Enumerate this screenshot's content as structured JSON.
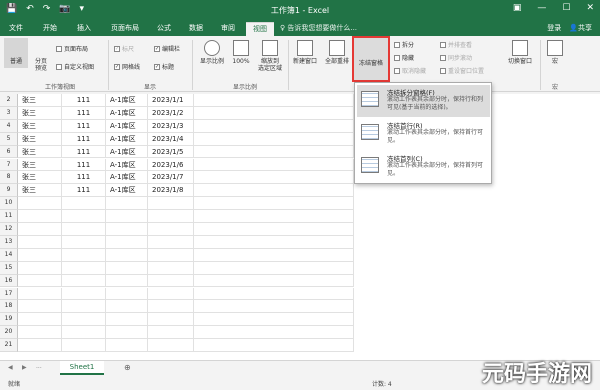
{
  "window": {
    "title": "工作簿1 - Excel"
  },
  "qat": {
    "save": "💾",
    "undo": "↶",
    "redo": "↷",
    "camera": "📷",
    "more": "▾"
  },
  "winbtns": {
    "ribbon_opts": "▣",
    "minimize": "—",
    "maximize": "☐",
    "close": "✕"
  },
  "tabs": [
    "文件",
    "开始",
    "插入",
    "页面布局",
    "公式",
    "数据",
    "审阅",
    "视图"
  ],
  "tellme": "♀ 告诉我您想要做什么...",
  "account": {
    "login": "登录",
    "share": "共享"
  },
  "ribbon": {
    "views": {
      "normal": "普通",
      "pagebreak_1": "分页",
      "pagebreak_2": "预览",
      "page_layout": "页面布局",
      "custom_views": "自定义视图",
      "group": "工作簿视图"
    },
    "show": {
      "ruler": "标尺",
      "formula_bar": "编辑栏",
      "gridlines": "网格线",
      "headings": "标题",
      "group": "显示"
    },
    "zoom": {
      "zoom": "显示比例",
      "hundred": "100%",
      "to_sel_1": "缩放到",
      "to_sel_2": "选定区域",
      "group": "显示比例"
    },
    "window": {
      "new_window": "新建窗口",
      "arrange_all": "全部重排",
      "freeze": "冻结窗格",
      "split": "拆分",
      "hide": "隐藏",
      "unhide": "取消隐藏",
      "side_by_side": "并排查看",
      "sync_scroll": "同步滚动",
      "reset_pos": "重设窗口位置",
      "switch": "切换窗口"
    },
    "macro": {
      "label": "宏",
      "group": "宏"
    }
  },
  "freeze_menu": [
    {
      "title": "冻结拆分窗格(F)",
      "desc": "滚动工作表其余部分时，保持行和列可见(基于当前的选择)。"
    },
    {
      "title": "冻结首行(R)",
      "desc": "滚动工作表其余部分时，保持首行可见。"
    },
    {
      "title": "冻结首列(C)",
      "desc": "滚动工作表其余部分时，保持首列可见。"
    }
  ],
  "rows": [
    {
      "n": "2",
      "a": "张三",
      "b": "111",
      "c": "A-1库区",
      "d": "2023/1/1"
    },
    {
      "n": "3",
      "a": "张三",
      "b": "111",
      "c": "A-1库区",
      "d": "2023/1/2"
    },
    {
      "n": "4",
      "a": "张三",
      "b": "111",
      "c": "A-1库区",
      "d": "2023/1/3"
    },
    {
      "n": "5",
      "a": "张三",
      "b": "111",
      "c": "A-1库区",
      "d": "2023/1/4"
    },
    {
      "n": "6",
      "a": "张三",
      "b": "111",
      "c": "A-1库区",
      "d": "2023/1/5"
    },
    {
      "n": "7",
      "a": "张三",
      "b": "111",
      "c": "A-1库区",
      "d": "2023/1/6"
    },
    {
      "n": "8",
      "a": "张三",
      "b": "111",
      "c": "A-1库区",
      "d": "2023/1/7"
    },
    {
      "n": "9",
      "a": "张三",
      "b": "111",
      "c": "A-1库区",
      "d": "2023/1/8"
    },
    {
      "n": "10"
    },
    {
      "n": "11"
    },
    {
      "n": "12"
    },
    {
      "n": "13"
    },
    {
      "n": "14"
    },
    {
      "n": "15"
    },
    {
      "n": "16"
    },
    {
      "n": "17"
    },
    {
      "n": "18"
    },
    {
      "n": "19"
    },
    {
      "n": "20"
    },
    {
      "n": "21"
    }
  ],
  "sheetbar": {
    "sheet_tab": "Sheet1",
    "add": "⊕",
    "prev": "◀",
    "next": "▶",
    "more": "..."
  },
  "status": {
    "ready": "就绪",
    "count": "计数: 4"
  },
  "watermark": "元码手游网"
}
